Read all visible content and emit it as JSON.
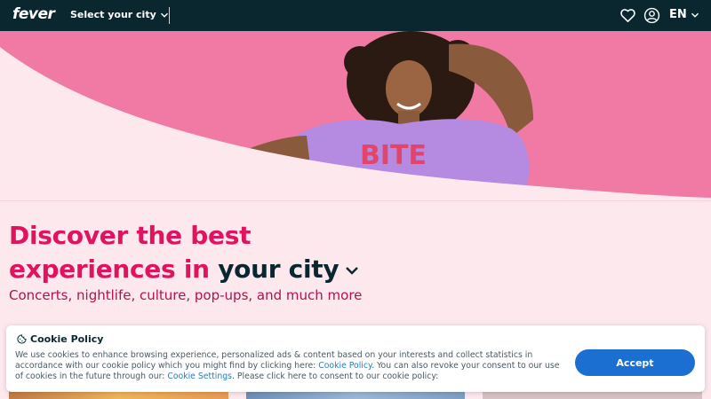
{
  "header": {
    "logo": "fever",
    "city_select_label": "Select your city",
    "language": "EN",
    "icons": [
      "heart-icon",
      "user-icon",
      "chevron-down-icon"
    ]
  },
  "hero": {
    "shirt_text": "BITE",
    "colors": {
      "pink": "#f07aa3",
      "cream": "#fde8ee",
      "shirt": "#b48be0"
    }
  },
  "main": {
    "headline_line1": "Discover the best",
    "headline_line2": "experiences in",
    "city_link": "your city",
    "subline": "Concerts, nightlife, culture, pop-ups, and much more"
  },
  "cookie": {
    "title": "Cookie Policy",
    "text_1": "We use cookies to enhance browsing experience, personalized ads & content based on your interests and collect statistics in accordance with our cookie policy which you might find by clicking here: ",
    "link_policy": "Cookie Policy",
    "text_2": ". You can also revoke your consent to our use of cookies in the future through our: ",
    "link_settings": "Cookie Settings",
    "text_3": ". Please click here to consent to our cookie policy:",
    "accept_label": "Accept"
  },
  "colors": {
    "header_bg": "#0a2730",
    "accent": "#e0135f",
    "button": "#1a6fd1"
  }
}
